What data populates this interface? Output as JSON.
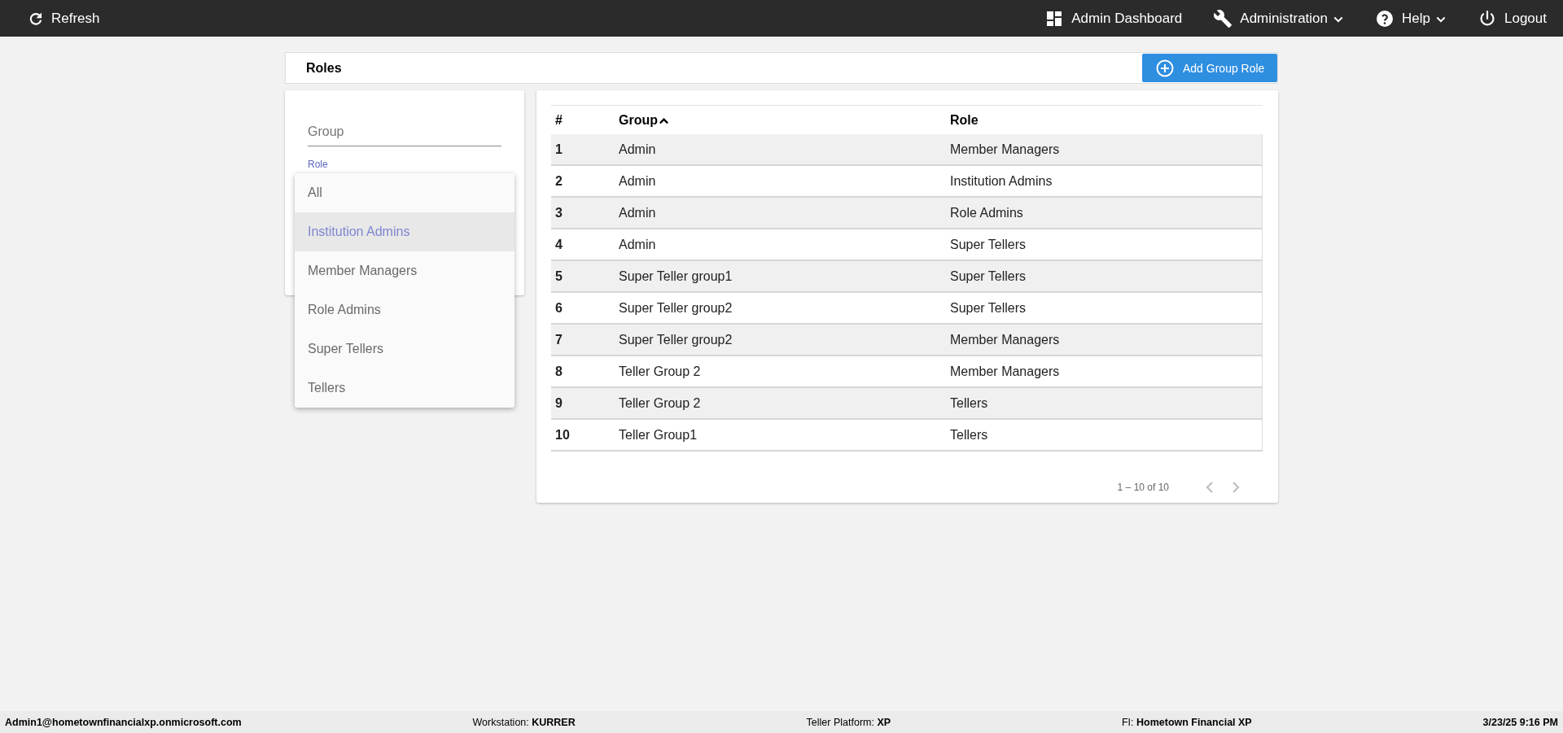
{
  "topbar": {
    "refresh": {
      "label": "Refresh"
    },
    "items": [
      {
        "label": "Admin Dashboard",
        "has_menu": false
      },
      {
        "label": "Administration",
        "has_menu": true
      },
      {
        "label": "Help",
        "has_menu": true
      },
      {
        "label": "Logout",
        "has_menu": false
      }
    ]
  },
  "page": {
    "title": "Roles",
    "add_button": "Add Group Role"
  },
  "filter": {
    "group_field": {
      "placeholder": "Group"
    },
    "role_field": {
      "label": "Role"
    },
    "role_menu": {
      "options": [
        {
          "label": "All",
          "selected": false
        },
        {
          "label": "Institution Admins",
          "selected": true
        },
        {
          "label": "Member Managers",
          "selected": false
        },
        {
          "label": "Role Admins",
          "selected": false
        },
        {
          "label": "Super Tellers",
          "selected": false
        },
        {
          "label": "Tellers",
          "selected": false
        }
      ]
    }
  },
  "table": {
    "columns": [
      {
        "label": "#",
        "sorted": false
      },
      {
        "label": "Group",
        "sorted": true
      },
      {
        "label": "Role",
        "sorted": false
      }
    ],
    "rows": [
      [
        "1",
        "Admin",
        "Member Managers"
      ],
      [
        "2",
        "Admin",
        "Institution Admins"
      ],
      [
        "3",
        "Admin",
        "Role Admins"
      ],
      [
        "4",
        "Admin",
        "Super Tellers"
      ],
      [
        "5",
        "Super Teller group1",
        "Super Tellers"
      ],
      [
        "6",
        "Super Teller group2",
        "Super Tellers"
      ],
      [
        "7",
        "Super Teller group2",
        "Member Managers"
      ],
      [
        "8",
        "Teller Group 2",
        "Member Managers"
      ],
      [
        "9",
        "Teller Group 2",
        "Tellers"
      ],
      [
        "10",
        "Teller Group1",
        "Tellers"
      ]
    ],
    "pagination": {
      "range": "1 – 10 of 10",
      "prev_disabled": true,
      "next_disabled": true
    }
  },
  "status_bar": [
    {
      "value": "Admin1@hometownfinancialxp.onmicrosoft.com"
    },
    {
      "label": "Workstation:",
      "value": "KURRER"
    },
    {
      "label": "Teller Platform:",
      "value": "XP"
    },
    {
      "label": "FI:",
      "value": "Hometown Financial XP"
    },
    {
      "value": "3/23/25 9:16 PM"
    }
  ]
}
